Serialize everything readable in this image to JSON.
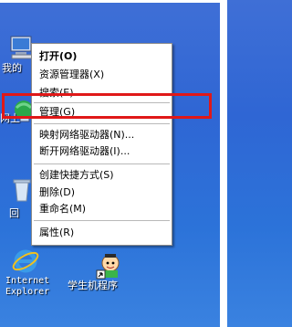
{
  "desktop": {
    "icons": [
      {
        "label": "我的",
        "icon": "my-computer-icon"
      },
      {
        "label": "网上",
        "icon": "network-places-icon"
      },
      {
        "label": "回",
        "icon": "recycle-bin-icon"
      },
      {
        "label": "Internet\nExplorer",
        "icon": "internet-explorer-icon"
      },
      {
        "label": "学生机程序",
        "icon": "student-program-icon"
      }
    ]
  },
  "context_menu": {
    "items": [
      {
        "label": "打开(O)"
      },
      {
        "label": "资源管理器(X)"
      },
      {
        "label": "搜索(E)..."
      },
      {
        "label": "管理(G)"
      },
      {
        "label": "映射网络驱动器(N)..."
      },
      {
        "label": "断开网络驱动器(I)..."
      },
      {
        "label": "创建快捷方式(S)"
      },
      {
        "label": "删除(D)"
      },
      {
        "label": "重命名(M)"
      },
      {
        "label": "属性(R)"
      }
    ]
  },
  "annotation": {
    "color": "#e01818"
  }
}
